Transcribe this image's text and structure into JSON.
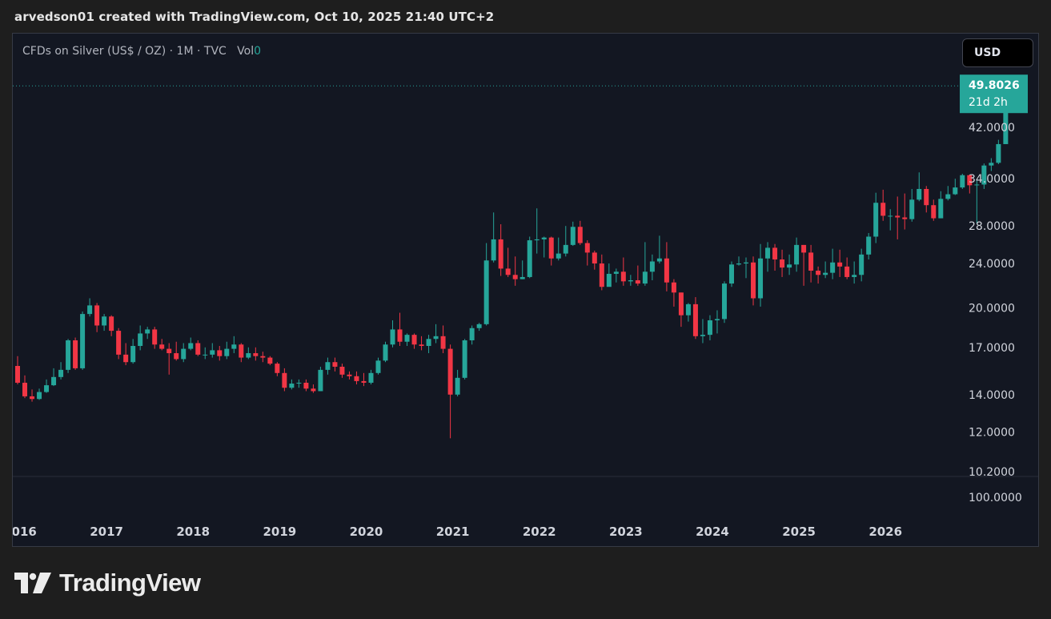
{
  "header": {
    "attribution": "arvedson01 created with TradingView.com, Oct 10, 2025 21:40 UTC+2"
  },
  "symbol": {
    "label": "CFDs on Silver (US$ / OZ) · 1M · TVC",
    "vol_label": "Vol",
    "vol_value": "0"
  },
  "currency_button": {
    "label": "USD"
  },
  "last_price": {
    "value": "49.8026",
    "countdown": "21d 2h"
  },
  "footer": {
    "brand": "TradingView"
  },
  "colors": {
    "up": "#26a69a",
    "down": "#f23645",
    "panel": "#131722",
    "grid_line": "#2a2e39",
    "text": "#d1d4dc",
    "price_tag": "#26a69a"
  },
  "chart_data": {
    "type": "candlestick",
    "title": "CFDs on Silver (US$ / OZ) · 1M · TVC",
    "interval": "1M",
    "scale": "log",
    "ylim": [
      10.2,
      52
    ],
    "y_ticks": [
      "42.0000",
      "34.0000",
      "28.0000",
      "24.0000",
      "20.0000",
      "17.0000",
      "14.0000",
      "12.0000",
      "10.2000"
    ],
    "y_tick_values": [
      42,
      34,
      28,
      24,
      20,
      17,
      14,
      12,
      10.2
    ],
    "volume_pane_tick": "100.0000",
    "x_ticks": [
      "2016",
      "2017",
      "2018",
      "2019",
      "2020",
      "2021",
      "2022",
      "2023",
      "2024",
      "2025",
      "2026"
    ],
    "start_month": "2016-01",
    "last_price": 49.8026,
    "candles": [
      [
        15.75,
        14.7,
        16.4,
        14.6
      ],
      [
        14.7,
        13.9,
        15.15,
        13.8
      ],
      [
        13.9,
        13.75,
        14.3,
        13.6
      ],
      [
        13.75,
        14.15,
        14.35,
        13.7
      ],
      [
        14.15,
        14.55,
        14.9,
        14.1
      ],
      [
        14.55,
        15.05,
        15.6,
        14.5
      ],
      [
        15.05,
        15.5,
        16.0,
        14.9
      ],
      [
        15.5,
        17.5,
        17.6,
        15.3
      ],
      [
        17.5,
        15.6,
        17.7,
        15.5
      ],
      [
        15.6,
        19.5,
        19.7,
        15.5
      ],
      [
        19.5,
        20.2,
        20.8,
        19.3
      ],
      [
        20.2,
        18.6,
        20.4,
        18.1
      ],
      [
        18.6,
        19.3,
        19.5,
        18.2
      ],
      [
        19.3,
        18.2,
        19.4,
        17.8
      ],
      [
        18.2,
        16.5,
        18.4,
        16.2
      ],
      [
        16.5,
        16.0,
        17.3,
        15.8
      ],
      [
        16.0,
        17.1,
        17.6,
        15.9
      ],
      [
        17.1,
        18.0,
        18.6,
        16.8
      ],
      [
        18.0,
        18.3,
        18.5,
        17.6
      ],
      [
        18.3,
        17.2,
        18.5,
        16.9
      ],
      [
        17.2,
        16.9,
        17.6,
        16.8
      ],
      [
        16.9,
        16.6,
        17.3,
        15.2
      ],
      [
        16.6,
        16.2,
        17.4,
        16.1
      ],
      [
        16.2,
        16.9,
        17.3,
        16.0
      ],
      [
        16.9,
        17.3,
        17.7,
        16.8
      ],
      [
        17.3,
        16.5,
        17.5,
        16.4
      ],
      [
        16.5,
        16.5,
        17.0,
        16.2
      ],
      [
        16.5,
        16.8,
        17.3,
        16.3
      ],
      [
        16.8,
        16.4,
        17.1,
        16.1
      ],
      [
        16.4,
        16.9,
        17.4,
        16.2
      ],
      [
        16.9,
        17.2,
        17.8,
        16.6
      ],
      [
        17.2,
        16.3,
        17.3,
        16.0
      ],
      [
        16.3,
        16.6,
        17.0,
        16.2
      ],
      [
        16.6,
        16.4,
        17.0,
        16.1
      ],
      [
        16.4,
        16.3,
        16.7,
        16.0
      ],
      [
        16.3,
        15.9,
        16.4,
        15.8
      ],
      [
        15.9,
        15.3,
        16.0,
        15.1
      ],
      [
        15.3,
        14.4,
        15.6,
        14.2
      ],
      [
        14.4,
        14.65,
        14.9,
        14.3
      ],
      [
        14.65,
        14.7,
        14.9,
        14.4
      ],
      [
        14.7,
        14.35,
        14.9,
        14.2
      ],
      [
        14.35,
        14.2,
        14.6,
        14.1
      ],
      [
        14.2,
        15.5,
        15.7,
        14.2
      ],
      [
        15.5,
        16.0,
        16.3,
        15.2
      ],
      [
        16.0,
        15.7,
        16.3,
        15.4
      ],
      [
        15.7,
        15.2,
        15.9,
        15.0
      ],
      [
        15.2,
        15.1,
        15.4,
        14.9
      ],
      [
        15.1,
        14.8,
        15.4,
        14.6
      ],
      [
        14.8,
        14.7,
        15.3,
        14.5
      ],
      [
        14.7,
        15.3,
        15.5,
        14.6
      ],
      [
        15.3,
        16.1,
        16.3,
        15.2
      ],
      [
        16.1,
        17.2,
        17.4,
        16.0
      ],
      [
        17.2,
        18.3,
        19.0,
        17.0
      ],
      [
        18.3,
        17.4,
        19.6,
        17.1
      ],
      [
        17.4,
        17.9,
        18.0,
        17.1
      ],
      [
        17.9,
        17.2,
        18.0,
        16.9
      ],
      [
        17.2,
        17.1,
        17.8,
        16.8
      ],
      [
        17.1,
        17.6,
        17.9,
        16.6
      ],
      [
        17.6,
        17.8,
        18.7,
        17.3
      ],
      [
        17.8,
        16.9,
        18.6,
        16.6
      ],
      [
        16.9,
        14.0,
        17.2,
        11.7
      ],
      [
        14.0,
        15.0,
        15.5,
        13.9
      ],
      [
        15.0,
        17.5,
        17.6,
        14.9
      ],
      [
        17.5,
        18.4,
        18.6,
        17.2
      ],
      [
        18.4,
        18.7,
        18.8,
        18.2
      ],
      [
        18.7,
        24.3,
        26.1,
        18.6
      ],
      [
        24.3,
        26.5,
        29.6,
        24.1
      ],
      [
        26.5,
        23.5,
        28.2,
        22.8
      ],
      [
        23.5,
        22.9,
        25.6,
        22.7
      ],
      [
        22.9,
        22.5,
        24.7,
        21.9
      ],
      [
        22.5,
        22.7,
        24.3,
        22.5
      ],
      [
        22.7,
        26.4,
        26.8,
        22.6
      ],
      [
        26.4,
        26.5,
        30.1,
        25.0
      ],
      [
        26.5,
        26.7,
        26.8,
        24.6
      ],
      [
        26.7,
        24.5,
        26.8,
        23.8
      ],
      [
        24.5,
        25.0,
        26.7,
        24.3
      ],
      [
        25.0,
        25.9,
        28.0,
        24.7
      ],
      [
        25.9,
        27.9,
        28.5,
        25.8
      ],
      [
        27.9,
        26.1,
        28.6,
        25.9
      ],
      [
        26.1,
        25.1,
        26.4,
        23.8
      ],
      [
        25.1,
        24.0,
        25.3,
        23.4
      ],
      [
        24.0,
        21.8,
        24.9,
        21.5
      ],
      [
        21.8,
        23.0,
        24.0,
        22.0
      ],
      [
        23.0,
        23.2,
        23.5,
        22.2
      ],
      [
        23.2,
        22.3,
        24.6,
        21.9
      ],
      [
        22.3,
        22.4,
        22.9,
        21.9
      ],
      [
        22.4,
        22.1,
        23.8,
        21.9
      ],
      [
        22.1,
        23.2,
        26.2,
        21.9
      ],
      [
        23.2,
        24.2,
        24.9,
        22.4
      ],
      [
        24.2,
        24.5,
        26.9,
        24.0
      ],
      [
        24.5,
        22.2,
        26.2,
        21.4
      ],
      [
        22.2,
        21.3,
        22.5,
        20.1
      ],
      [
        21.3,
        19.4,
        21.3,
        18.5
      ],
      [
        19.4,
        20.3,
        20.4,
        18.9
      ],
      [
        20.3,
        17.8,
        20.9,
        17.6
      ],
      [
        17.8,
        17.9,
        19.1,
        17.3
      ],
      [
        17.9,
        19.0,
        19.4,
        17.5
      ],
      [
        19.0,
        19.1,
        19.8,
        18.0
      ],
      [
        19.1,
        22.1,
        22.3,
        18.8
      ],
      [
        22.1,
        23.9,
        24.2,
        21.8
      ],
      [
        23.9,
        24.0,
        24.7,
        23.8
      ],
      [
        24.0,
        24.1,
        24.6,
        22.6
      ],
      [
        24.1,
        20.8,
        24.7,
        20.2
      ],
      [
        20.8,
        24.5,
        26.0,
        20.1
      ],
      [
        24.5,
        25.6,
        26.2,
        23.2
      ],
      [
        25.6,
        24.4,
        26.0,
        23.3
      ],
      [
        24.4,
        23.6,
        25.4,
        22.7
      ],
      [
        23.6,
        23.9,
        24.9,
        22.9
      ],
      [
        23.9,
        25.9,
        26.7,
        23.2
      ],
      [
        25.9,
        25.1,
        25.9,
        21.9
      ],
      [
        25.1,
        23.3,
        25.9,
        22.2
      ],
      [
        23.3,
        22.9,
        23.7,
        22.1
      ],
      [
        22.9,
        23.1,
        24.2,
        22.6
      ],
      [
        23.1,
        24.1,
        25.5,
        22.5
      ],
      [
        24.1,
        23.7,
        25.4,
        22.7
      ],
      [
        23.7,
        22.7,
        24.6,
        22.5
      ],
      [
        22.7,
        22.9,
        24.2,
        22.1
      ],
      [
        22.9,
        24.9,
        25.5,
        22.3
      ],
      [
        24.9,
        26.8,
        27.2,
        24.4
      ],
      [
        26.8,
        30.8,
        32.1,
        26.1
      ],
      [
        30.8,
        29.2,
        32.5,
        28.6
      ],
      [
        29.2,
        29.2,
        30.0,
        27.5
      ],
      [
        29.2,
        29.0,
        31.6,
        26.5
      ],
      [
        29.0,
        28.8,
        32.0,
        27.6
      ],
      [
        28.8,
        31.2,
        32.6,
        28.5
      ],
      [
        31.2,
        32.6,
        34.9,
        31.0
      ],
      [
        32.6,
        30.5,
        33.0,
        29.6
      ],
      [
        30.5,
        28.9,
        31.2,
        28.6
      ],
      [
        28.9,
        31.3,
        32.3,
        28.9
      ],
      [
        31.3,
        31.9,
        33.0,
        31.1
      ],
      [
        31.9,
        32.8,
        34.0,
        31.8
      ],
      [
        32.8,
        34.5,
        34.7,
        32.6
      ],
      [
        34.5,
        33.1,
        34.6,
        32.0
      ],
      [
        33.1,
        33.2,
        33.9,
        28.3
      ],
      [
        33.2,
        35.9,
        36.2,
        32.6
      ],
      [
        35.9,
        36.3,
        37.0,
        35.1
      ],
      [
        36.3,
        39.2,
        39.9,
        36.1
      ],
      [
        39.2,
        46.6,
        47.2,
        39.2
      ],
      [
        46.6,
        49.8026,
        51.2,
        46.2
      ]
    ]
  }
}
